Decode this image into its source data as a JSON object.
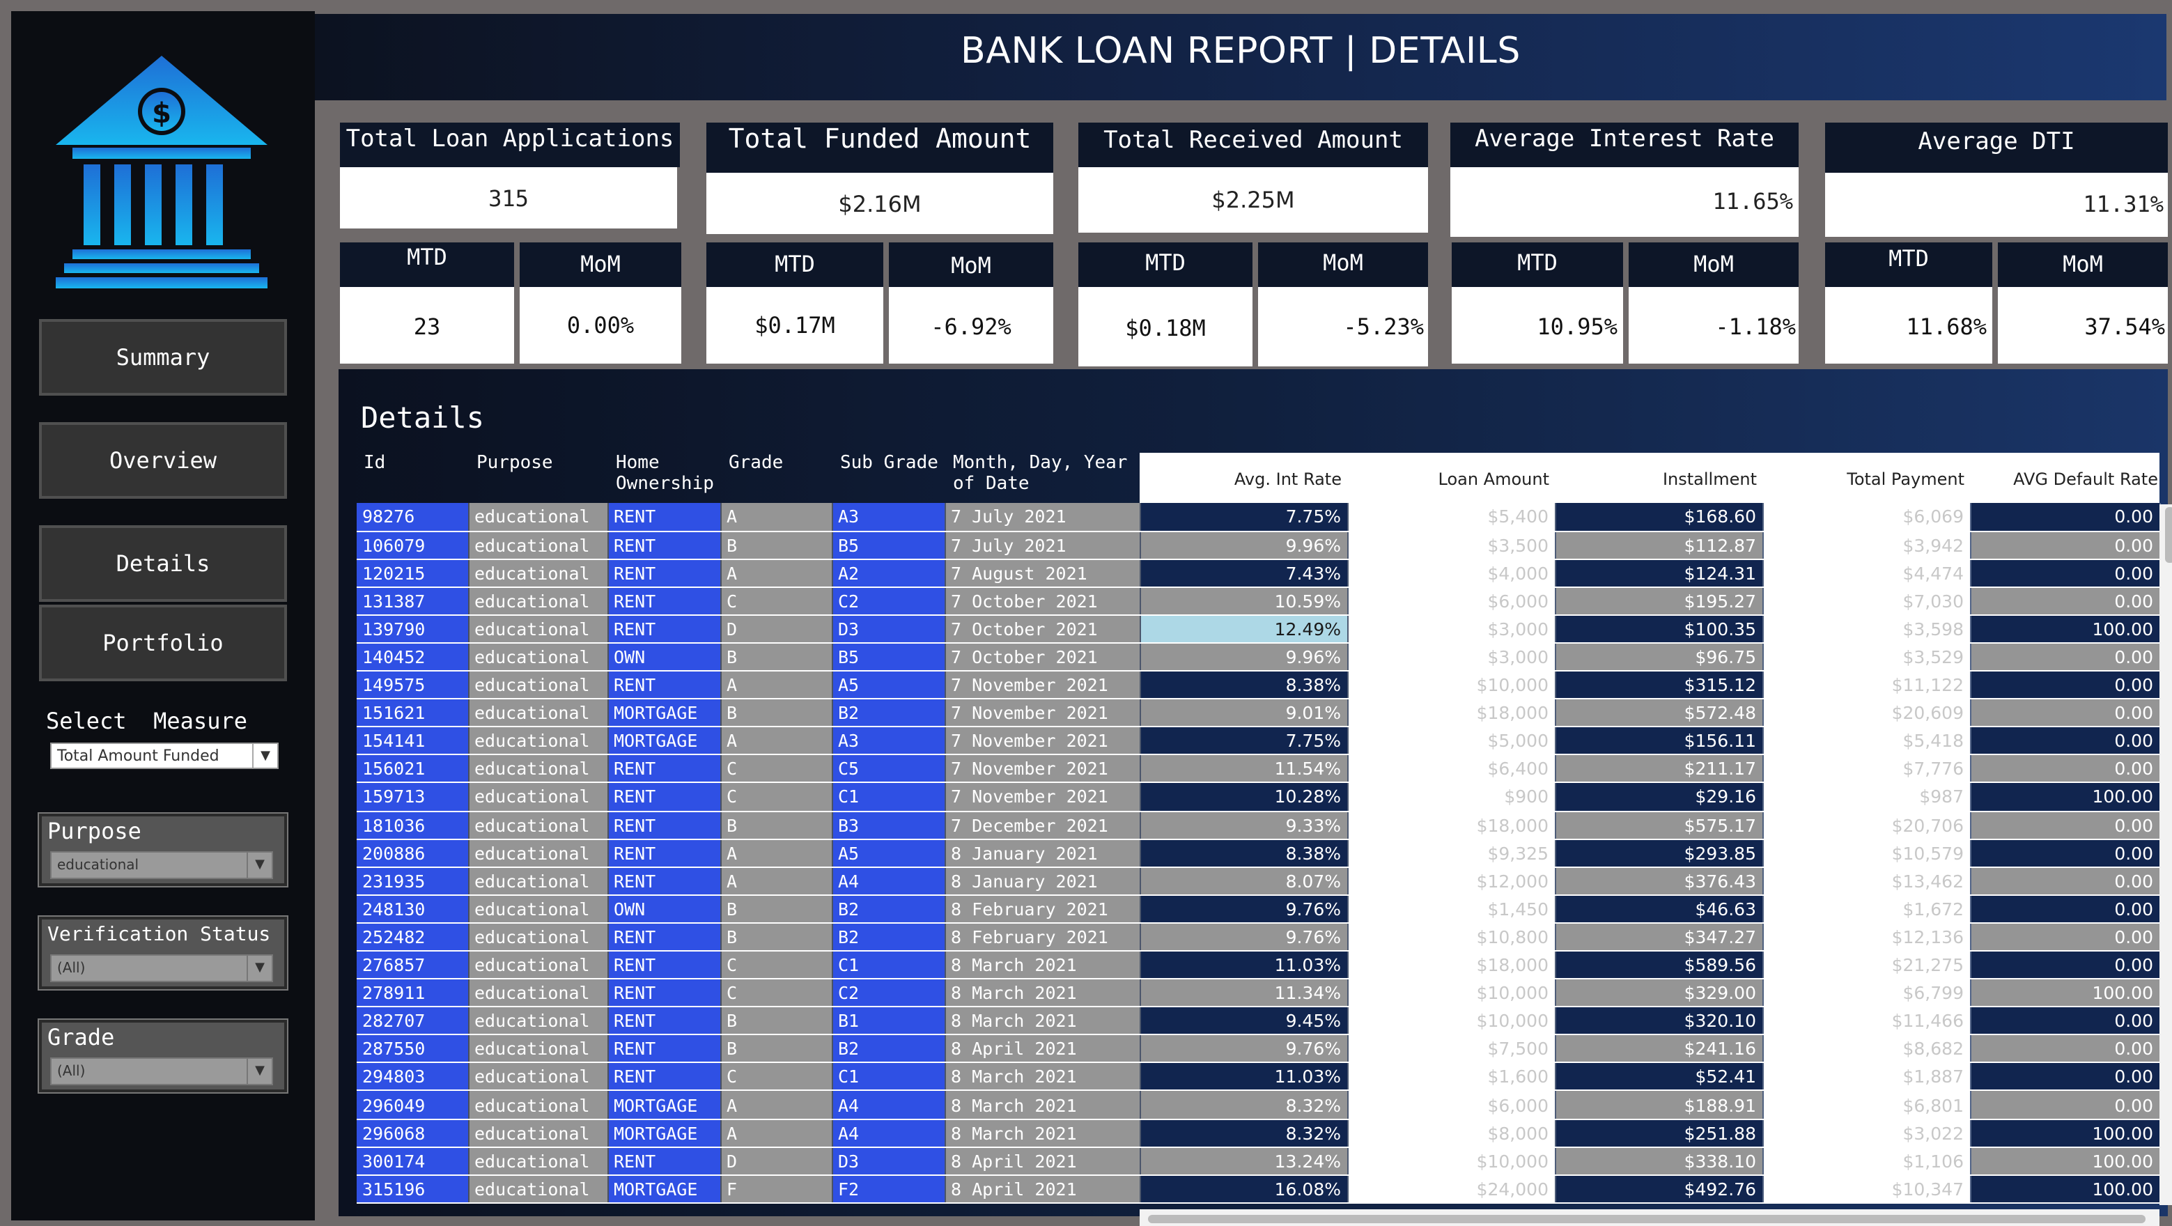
{
  "header": {
    "title": "BANK LOAN REPORT | DETAILS"
  },
  "nav": {
    "summary": "Summary",
    "overview": "Overview",
    "details": "Details",
    "portfolio": "Portfolio"
  },
  "measure": {
    "label": "Select  Measure",
    "value": "Total Amount Funded"
  },
  "filters": {
    "purpose": {
      "label": "Purpose",
      "value": "educational"
    },
    "verification": {
      "label": "Verification Status",
      "value": "(All)"
    },
    "grade": {
      "label": "Grade",
      "value": "(All)"
    }
  },
  "kpis": [
    {
      "title": "Total Loan Applications",
      "value": "315",
      "mtd_label": "MTD",
      "mtd": "23",
      "mom_label": "MoM",
      "mom": "0.00%"
    },
    {
      "title": "Total Funded Amount",
      "value": "$2.16M",
      "mtd_label": "MTD",
      "mtd": "$0.17M",
      "mom_label": "MoM",
      "mom": "-6.92%"
    },
    {
      "title": "Total Received Amount",
      "value": "$2.25M",
      "mtd_label": "MTD",
      "mtd": "$0.18M",
      "mom_label": "MoM",
      "mom": "-5.23%"
    },
    {
      "title": "Average Interest Rate",
      "value": "11.65%",
      "mtd_label": "MTD",
      "mtd": "10.95%",
      "mom_label": "MoM",
      "mom": "-1.18%"
    },
    {
      "title": "Average DTI",
      "value": "11.31%",
      "mtd_label": "MTD",
      "mtd": "11.68%",
      "mom_label": "MoM",
      "mom": "37.54%"
    }
  ],
  "details": {
    "title": "Details",
    "columns": {
      "id": "Id",
      "purpose": "Purpose",
      "home": "Home Ownership",
      "grade": "Grade",
      "sub_grade": "Sub Grade",
      "date": "Month, Day, Year of Date",
      "int_rate": "Avg. Int Rate",
      "loan_amount": "Loan Amount",
      "installment": "Installment",
      "total_payment": "Total Payment",
      "default_rate": "AVG Default Rate"
    },
    "colors": {
      "dark": "#11254f",
      "mid": "#959595",
      "light": "#ffffff",
      "highlight": "#add8e6",
      "blue": "#2f50e4"
    },
    "rows": [
      {
        "id": "98276",
        "purpose": "educational",
        "home": "RENT",
        "grade": "A",
        "sub": "A3",
        "date": "7 July 2021",
        "rate": "7.75%",
        "loan": "$5,400",
        "inst": "$168.60",
        "pay": "$6,069",
        "def": "0.00"
      },
      {
        "id": "106079",
        "purpose": "educational",
        "home": "RENT",
        "grade": "B",
        "sub": "B5",
        "date": "7 July 2021",
        "rate": "9.96%",
        "loan": "$3,500",
        "inst": "$112.87",
        "pay": "$3,942",
        "def": "0.00"
      },
      {
        "id": "120215",
        "purpose": "educational",
        "home": "RENT",
        "grade": "A",
        "sub": "A2",
        "date": "7 August 2021",
        "rate": "7.43%",
        "loan": "$4,000",
        "inst": "$124.31",
        "pay": "$4,474",
        "def": "0.00"
      },
      {
        "id": "131387",
        "purpose": "educational",
        "home": "RENT",
        "grade": "C",
        "sub": "C2",
        "date": "7 October 2021",
        "rate": "10.59%",
        "loan": "$6,000",
        "inst": "$195.27",
        "pay": "$7,030",
        "def": "0.00"
      },
      {
        "id": "139790",
        "purpose": "educational",
        "home": "RENT",
        "grade": "D",
        "sub": "D3",
        "date": "7 October 2021",
        "rate": "12.49%",
        "loan": "$3,000",
        "inst": "$100.35",
        "pay": "$3,598",
        "def": "100.00"
      },
      {
        "id": "140452",
        "purpose": "educational",
        "home": "OWN",
        "grade": "B",
        "sub": "B5",
        "date": "7 October 2021",
        "rate": "9.96%",
        "loan": "$3,000",
        "inst": "$96.75",
        "pay": "$3,529",
        "def": "0.00"
      },
      {
        "id": "149575",
        "purpose": "educational",
        "home": "RENT",
        "grade": "A",
        "sub": "A5",
        "date": "7 November 2021",
        "rate": "8.38%",
        "loan": "$10,000",
        "inst": "$315.12",
        "pay": "$11,122",
        "def": "0.00"
      },
      {
        "id": "151621",
        "purpose": "educational",
        "home": "MORTGAGE",
        "grade": "B",
        "sub": "B2",
        "date": "7 November 2021",
        "rate": "9.01%",
        "loan": "$18,000",
        "inst": "$572.48",
        "pay": "$20,609",
        "def": "0.00"
      },
      {
        "id": "154141",
        "purpose": "educational",
        "home": "MORTGAGE",
        "grade": "A",
        "sub": "A3",
        "date": "7 November 2021",
        "rate": "7.75%",
        "loan": "$5,000",
        "inst": "$156.11",
        "pay": "$5,418",
        "def": "0.00"
      },
      {
        "id": "156021",
        "purpose": "educational",
        "home": "RENT",
        "grade": "C",
        "sub": "C5",
        "date": "7 November 2021",
        "rate": "11.54%",
        "loan": "$6,400",
        "inst": "$211.17",
        "pay": "$7,776",
        "def": "0.00"
      },
      {
        "id": "159713",
        "purpose": "educational",
        "home": "RENT",
        "grade": "C",
        "sub": "C1",
        "date": "7 November 2021",
        "rate": "10.28%",
        "loan": "$900",
        "inst": "$29.16",
        "pay": "$987",
        "def": "100.00"
      },
      {
        "id": "181036",
        "purpose": "educational",
        "home": "RENT",
        "grade": "B",
        "sub": "B3",
        "date": "7 December 2021",
        "rate": "9.33%",
        "loan": "$18,000",
        "inst": "$575.17",
        "pay": "$20,706",
        "def": "0.00"
      },
      {
        "id": "200886",
        "purpose": "educational",
        "home": "RENT",
        "grade": "A",
        "sub": "A5",
        "date": "8 January 2021",
        "rate": "8.38%",
        "loan": "$9,325",
        "inst": "$293.85",
        "pay": "$10,579",
        "def": "0.00"
      },
      {
        "id": "231935",
        "purpose": "educational",
        "home": "RENT",
        "grade": "A",
        "sub": "A4",
        "date": "8 January 2021",
        "rate": "8.07%",
        "loan": "$12,000",
        "inst": "$376.43",
        "pay": "$13,462",
        "def": "0.00"
      },
      {
        "id": "248130",
        "purpose": "educational",
        "home": "OWN",
        "grade": "B",
        "sub": "B2",
        "date": "8 February 2021",
        "rate": "9.76%",
        "loan": "$1,450",
        "inst": "$46.63",
        "pay": "$1,672",
        "def": "0.00"
      },
      {
        "id": "252482",
        "purpose": "educational",
        "home": "RENT",
        "grade": "B",
        "sub": "B2",
        "date": "8 February 2021",
        "rate": "9.76%",
        "loan": "$10,800",
        "inst": "$347.27",
        "pay": "$12,136",
        "def": "0.00"
      },
      {
        "id": "276857",
        "purpose": "educational",
        "home": "RENT",
        "grade": "C",
        "sub": "C1",
        "date": "8 March 2021",
        "rate": "11.03%",
        "loan": "$18,000",
        "inst": "$589.56",
        "pay": "$21,275",
        "def": "0.00"
      },
      {
        "id": "278911",
        "purpose": "educational",
        "home": "RENT",
        "grade": "C",
        "sub": "C2",
        "date": "8 March 2021",
        "rate": "11.34%",
        "loan": "$10,000",
        "inst": "$329.00",
        "pay": "$6,799",
        "def": "100.00"
      },
      {
        "id": "282707",
        "purpose": "educational",
        "home": "RENT",
        "grade": "B",
        "sub": "B1",
        "date": "8 March 2021",
        "rate": "9.45%",
        "loan": "$10,000",
        "inst": "$320.10",
        "pay": "$11,466",
        "def": "0.00"
      },
      {
        "id": "287550",
        "purpose": "educational",
        "home": "RENT",
        "grade": "B",
        "sub": "B2",
        "date": "8 April 2021",
        "rate": "9.76%",
        "loan": "$7,500",
        "inst": "$241.16",
        "pay": "$8,682",
        "def": "0.00"
      },
      {
        "id": "294803",
        "purpose": "educational",
        "home": "RENT",
        "grade": "C",
        "sub": "C1",
        "date": "8 March 2021",
        "rate": "11.03%",
        "loan": "$1,600",
        "inst": "$52.41",
        "pay": "$1,887",
        "def": "0.00"
      },
      {
        "id": "296049",
        "purpose": "educational",
        "home": "MORTGAGE",
        "grade": "A",
        "sub": "A4",
        "date": "8 March 2021",
        "rate": "8.32%",
        "loan": "$6,000",
        "inst": "$188.91",
        "pay": "$6,801",
        "def": "0.00"
      },
      {
        "id": "296068",
        "purpose": "educational",
        "home": "MORTGAGE",
        "grade": "A",
        "sub": "A4",
        "date": "8 March 2021",
        "rate": "8.32%",
        "loan": "$8,000",
        "inst": "$251.88",
        "pay": "$3,022",
        "def": "100.00"
      },
      {
        "id": "300174",
        "purpose": "educational",
        "home": "RENT",
        "grade": "D",
        "sub": "D3",
        "date": "8 April 2021",
        "rate": "13.24%",
        "loan": "$10,000",
        "inst": "$338.10",
        "pay": "$1,106",
        "def": "100.00"
      },
      {
        "id": "315196",
        "purpose": "educational",
        "home": "MORTGAGE",
        "grade": "F",
        "sub": "F2",
        "date": "8 April 2021",
        "rate": "16.08%",
        "loan": "$24,000",
        "inst": "$492.76",
        "pay": "$10,347",
        "def": "100.00"
      }
    ]
  }
}
